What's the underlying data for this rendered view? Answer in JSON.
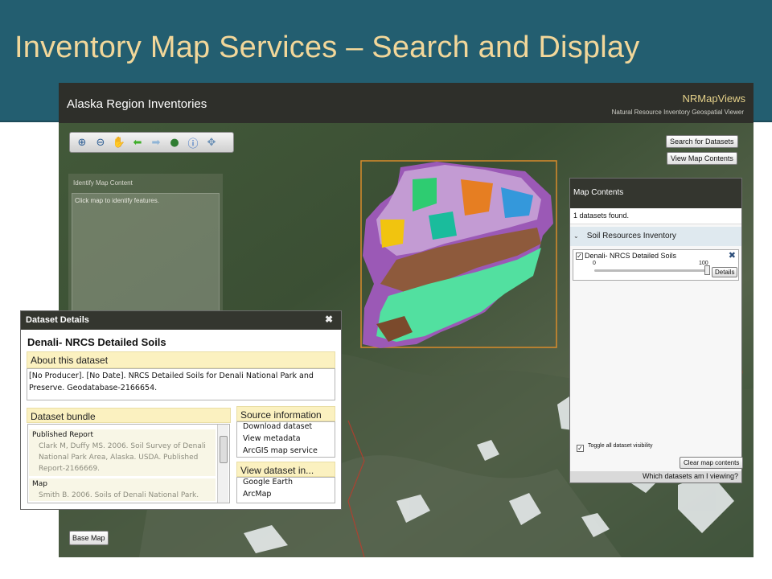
{
  "slide": {
    "title": "Inventory Map Services – Search and Display"
  },
  "app": {
    "title": "Alaska Region Inventories",
    "brand": "NRMapViews",
    "brand_subtitle": "Natural Resource Inventory Geospatial Viewer"
  },
  "toolbar": {
    "tools": [
      "zoom-in-icon",
      "zoom-out-icon",
      "pan-hand-icon",
      "previous-extent-icon",
      "next-extent-icon",
      "full-extent-globe-icon",
      "info-icon",
      "move-arrows-icon"
    ]
  },
  "buttons": {
    "search_datasets": "Search for Datasets",
    "view_map_contents": "View Map Contents",
    "base_map": "Base Map"
  },
  "identify": {
    "title": "Identify Map Content",
    "hint": "Click map to identify features."
  },
  "map_contents": {
    "title": "Map Contents",
    "count": "1 datasets found.",
    "group": "Soil Resources Inventory",
    "layer": {
      "name": "Denali- NRCS Detailed Soils",
      "checked": true,
      "slider_min": "0",
      "slider_max": "100",
      "opacity": 100,
      "details_label": "Details",
      "close": "✖"
    },
    "toggle_label": "Toggle all dataset visibility",
    "clear_label": "Clear map contents",
    "which_label": "Which datasets am I viewing?"
  },
  "dataset_details": {
    "title": "Dataset Details",
    "close": "✖",
    "name": "Denali- NRCS Detailed Soils",
    "about_heading": "About this dataset",
    "about_text": "[No Producer]. [No Date]. NRCS Detailed Soils for Denali National Park and Preserve. Geodatabase-2166654.",
    "bundle_heading": "Dataset bundle",
    "bundle": [
      {
        "type": "Published Report",
        "desc": "Clark M, Duffy MS. 2006. Soil Survey of Denali National Park Area, Alaska. USDA. Published Report-2166669."
      },
      {
        "type": "Map",
        "desc": "Smith B. 2006. Soils of Denali National Park."
      }
    ],
    "source_heading": "Source information",
    "source_links": [
      "Download dataset",
      "View metadata",
      "ArcGIS map service"
    ],
    "view_heading": "View dataset in...",
    "view_links": [
      "Google Earth",
      "ArcMap"
    ]
  }
}
